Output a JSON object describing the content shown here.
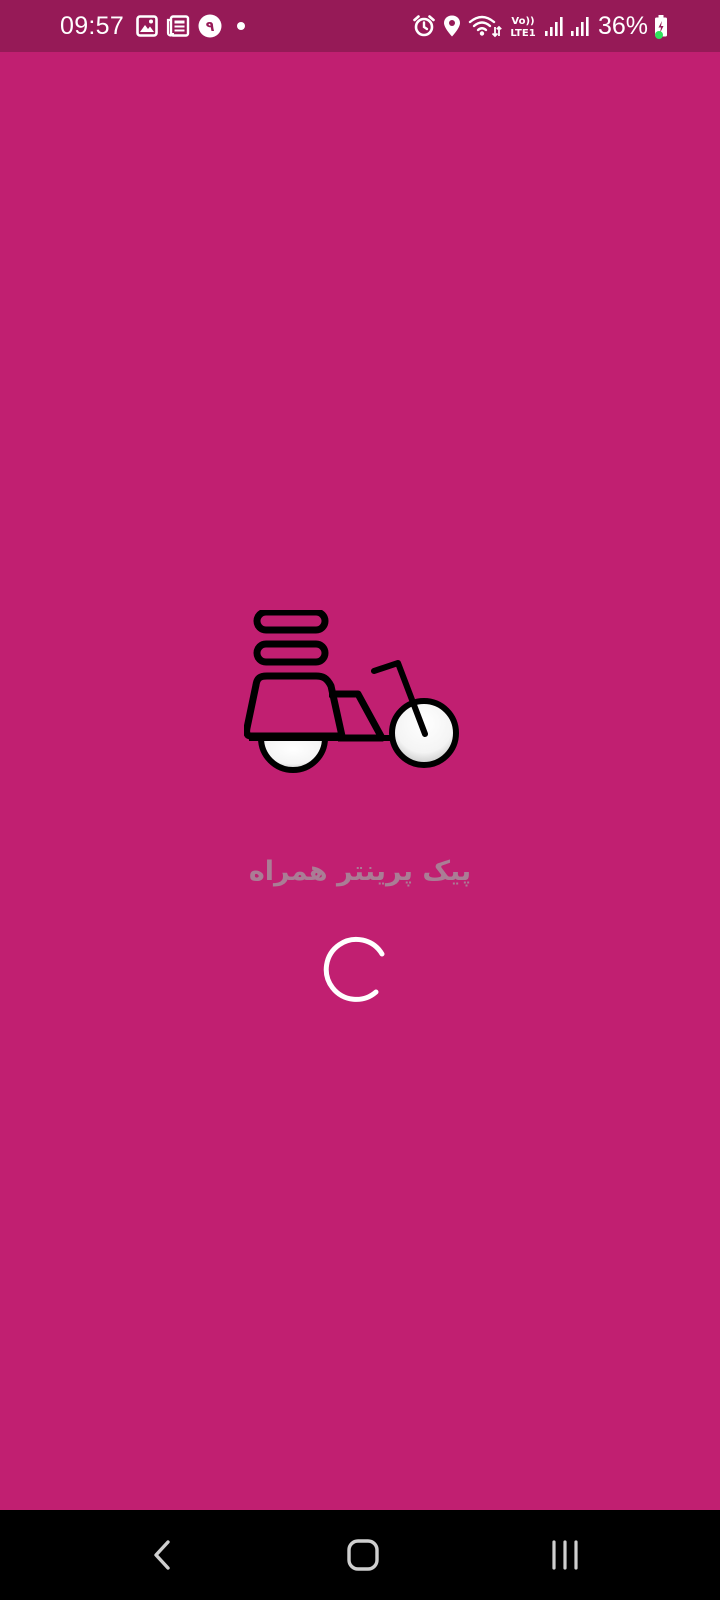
{
  "status_bar": {
    "time": "09:57",
    "notification_icons": [
      "image-icon",
      "news-icon",
      "calendar-badge-icon",
      "dot-icon"
    ],
    "calendar_badge_text": "۹",
    "system_icons": [
      "alarm-icon",
      "location-icon",
      "wifi-icon",
      "volte-lte-icon",
      "signal-icon",
      "signal-icon"
    ],
    "volte_top": "Vo))",
    "volte_bottom": "LTE1",
    "battery_percent": "36%"
  },
  "splash": {
    "app_name": "پیک پرینتر همراه",
    "logo_icon": "delivery-scooter-icon",
    "loading_icon": "loading-spinner-icon"
  },
  "nav_bar": {
    "buttons": [
      "back-icon",
      "home-icon",
      "recents-icon"
    ]
  },
  "colors": {
    "background": "#c11f71",
    "status_bar": "#961a57",
    "nav_bar": "#000000",
    "title_text": "#aa7d95",
    "spinner": "#ffffff",
    "charging_dot": "#2fe35c"
  }
}
